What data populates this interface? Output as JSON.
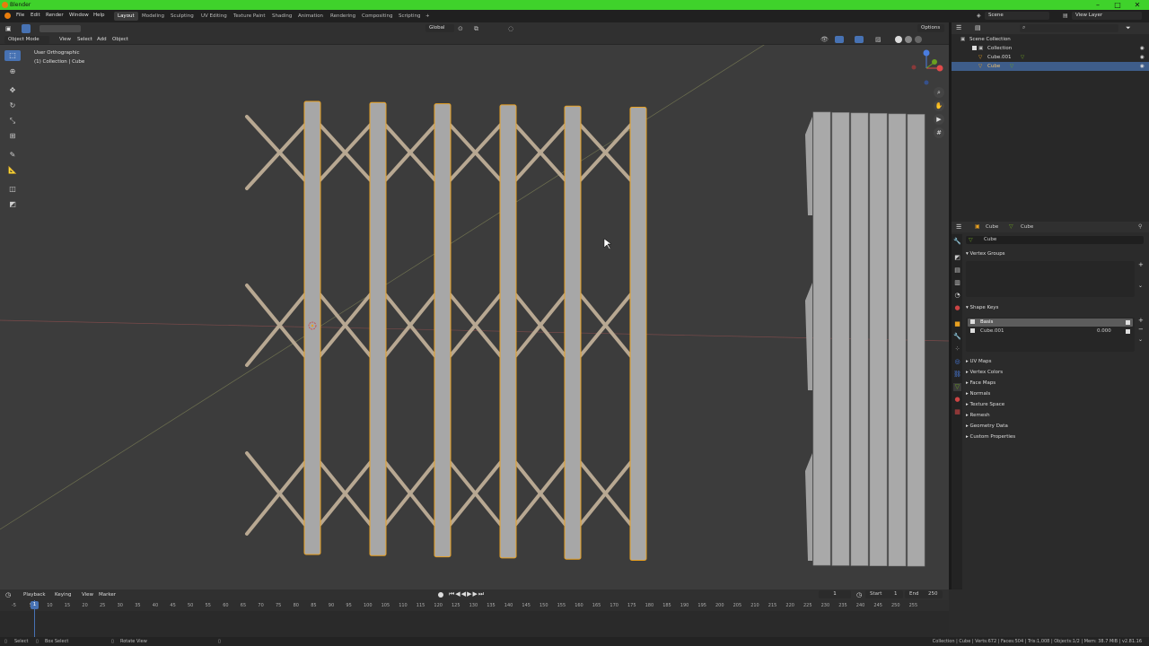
{
  "window": {
    "title": "Blender"
  },
  "menus": [
    "File",
    "Edit",
    "Render",
    "Window",
    "Help"
  ],
  "workspaces": [
    "Layout",
    "Modeling",
    "Sculpting",
    "UV Editing",
    "Texture Paint",
    "Shading",
    "Animation",
    "Rendering",
    "Compositing",
    "Scripting"
  ],
  "active_workspace": "Layout",
  "scene": {
    "name": "Scene",
    "view_layer": "View Layer"
  },
  "viewport": {
    "mode": "Object Mode",
    "menus": [
      "View",
      "Select",
      "Add",
      "Object"
    ],
    "transform_orientation": "Global",
    "options_label": "Options",
    "overlay_title": "User Orthographic",
    "overlay_subtitle": "(1) Collection | Cube"
  },
  "outliner": {
    "search_placeholder": "",
    "rows": [
      {
        "label": "Scene Collection"
      },
      {
        "label": "Collection"
      },
      {
        "label": "Cube.001"
      },
      {
        "label": "Cube"
      }
    ]
  },
  "properties": {
    "header_object": "Cube",
    "header_data": "Cube",
    "data_name": "Cube",
    "vertex_groups_label": "Vertex Groups",
    "shape_keys_label": "Shape Keys",
    "shape_keys": [
      {
        "name": "Basis",
        "value": ""
      },
      {
        "name": "Cube.001",
        "value": "0.000"
      }
    ],
    "panels": [
      "UV Maps",
      "Vertex Colors",
      "Face Maps",
      "Normals",
      "Texture Space",
      "Remesh",
      "Geometry Data",
      "Custom Properties"
    ]
  },
  "timeline": {
    "menus": [
      "Playback",
      "Keying",
      "View",
      "Marker"
    ],
    "current_frame": "1",
    "start_label": "Start",
    "start": "1",
    "end_label": "End",
    "end": "250",
    "ruler": [
      "-5",
      "5",
      "10",
      "15",
      "20",
      "25",
      "30",
      "35",
      "40",
      "45",
      "50",
      "55",
      "60",
      "65",
      "70",
      "75",
      "80",
      "85",
      "90",
      "95",
      "100",
      "105",
      "110",
      "115",
      "120",
      "125",
      "130",
      "135",
      "140",
      "145",
      "150",
      "155",
      "160",
      "165",
      "170",
      "175",
      "180",
      "185",
      "190",
      "195",
      "200",
      "205",
      "210",
      "215",
      "220",
      "225",
      "230",
      "235",
      "240",
      "245",
      "250",
      "255"
    ]
  },
  "statusbar": {
    "select": "Select",
    "box_select": "Box Select",
    "rotate_view": "Rotate View",
    "stats": "Collection | Cube | Verts:672 | Faces:504 | Tris:1,008 | Objects:1/2 | Mem: 38.7 MiB | v2.81.16"
  }
}
